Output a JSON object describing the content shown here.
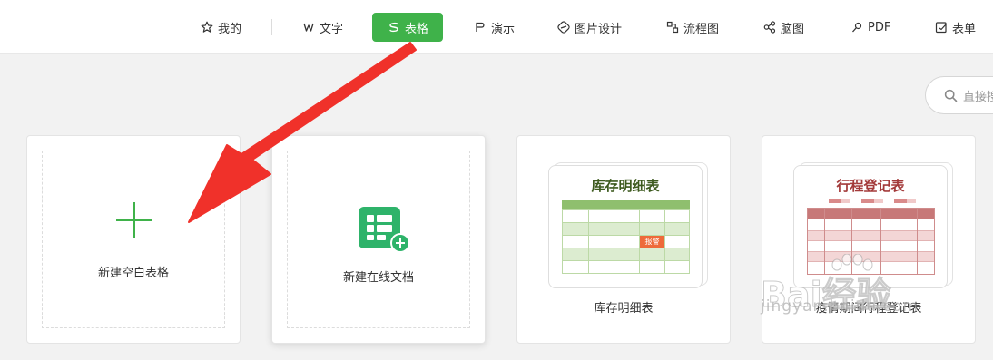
{
  "nav": {
    "items": [
      {
        "label": "我的",
        "icon": "star-icon"
      },
      {
        "label": "文字",
        "icon": "w-icon"
      },
      {
        "label": "表格",
        "icon": "s-icon",
        "active": true
      },
      {
        "label": "演示",
        "icon": "p-icon"
      },
      {
        "label": "图片设计",
        "icon": "image-design-icon"
      },
      {
        "label": "流程图",
        "icon": "flowchart-icon"
      },
      {
        "label": "脑图",
        "icon": "mindmap-icon"
      },
      {
        "label": "PDF",
        "icon": "pdf-icon"
      },
      {
        "label": "表单",
        "icon": "form-icon"
      }
    ],
    "active_color": "#3fb24a"
  },
  "search": {
    "placeholder": "直接搜"
  },
  "cards": {
    "blank": {
      "label": "新建空白表格"
    },
    "online": {
      "label": "新建在线文档"
    },
    "inventory": {
      "label": "库存明细表",
      "thumb_title": "库存明细表",
      "thumb_badge": "报警"
    },
    "itinerary": {
      "label": "疫情期间行程登记表",
      "thumb_title": "行程登记表"
    }
  },
  "watermark": {
    "main": "Bai经验",
    "sub": "jingyan.baidu.com"
  },
  "colors": {
    "accent_green": "#3fb24a",
    "arrow_red": "#f0312a",
    "inventory_title": "#3d5a1e",
    "itinerary_title": "#a33a3a"
  }
}
